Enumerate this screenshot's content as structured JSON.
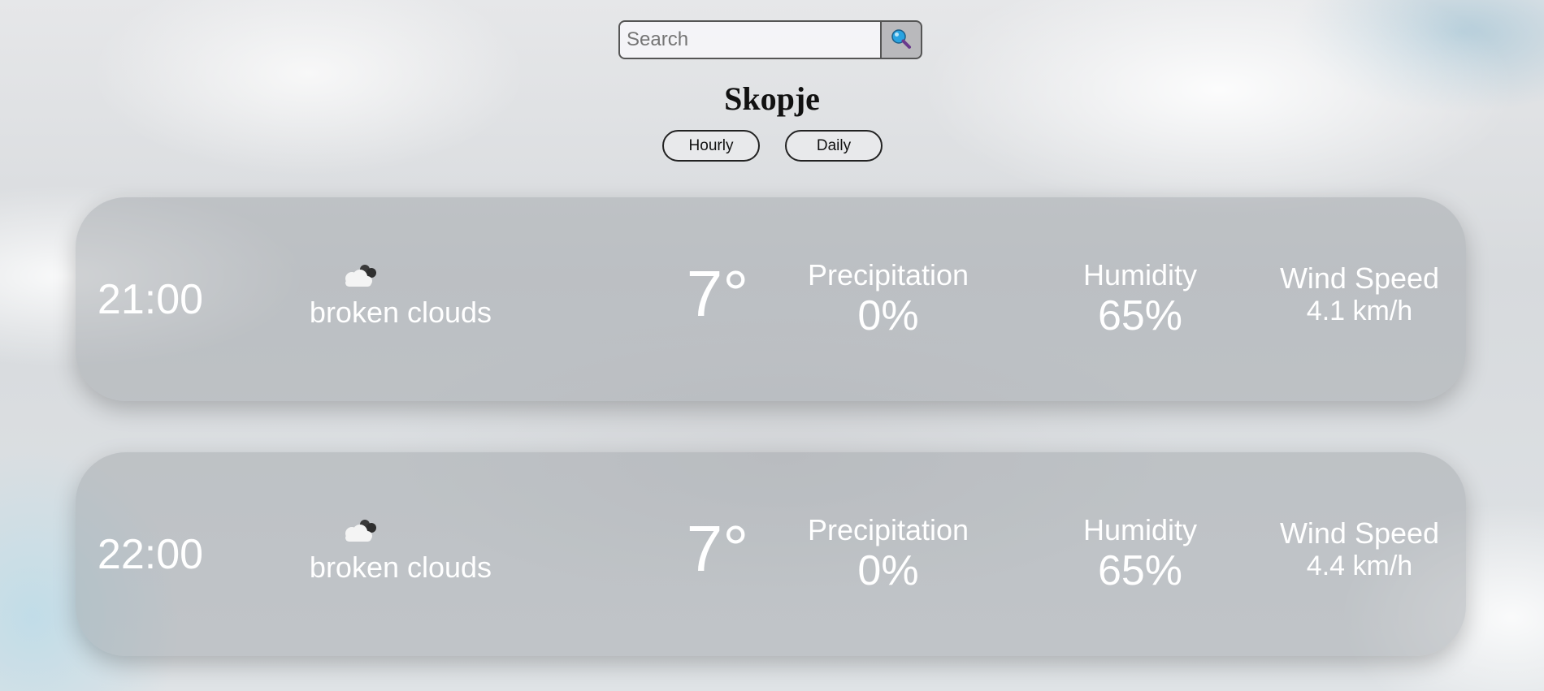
{
  "search": {
    "placeholder": "Search",
    "value": ""
  },
  "icons": {
    "search_button": "magnifier-icon",
    "weather": "broken-clouds-icon"
  },
  "city": "Skopje",
  "view_toggle": {
    "hourly_label": "Hourly",
    "daily_label": "Daily"
  },
  "forecast": [
    {
      "time": "21:00",
      "description": "broken clouds",
      "temperature": "7°",
      "precipitation_label": "Precipitation",
      "precipitation": "0%",
      "humidity_label": "Humidity",
      "humidity": "65%",
      "wind_label": "Wind Speed",
      "wind": "4.1 km/h"
    },
    {
      "time": "22:00",
      "description": "broken clouds",
      "temperature": "7°",
      "precipitation_label": "Precipitation",
      "precipitation": "0%",
      "humidity_label": "Humidity",
      "humidity": "65%",
      "wind_label": "Wind Speed",
      "wind": "4.4 km/h"
    }
  ],
  "colors": {
    "card_background": "#9a9fa4",
    "card_text": "#ffffff",
    "title_text": "#111111",
    "search_button_bg": "#b9b9bc"
  }
}
